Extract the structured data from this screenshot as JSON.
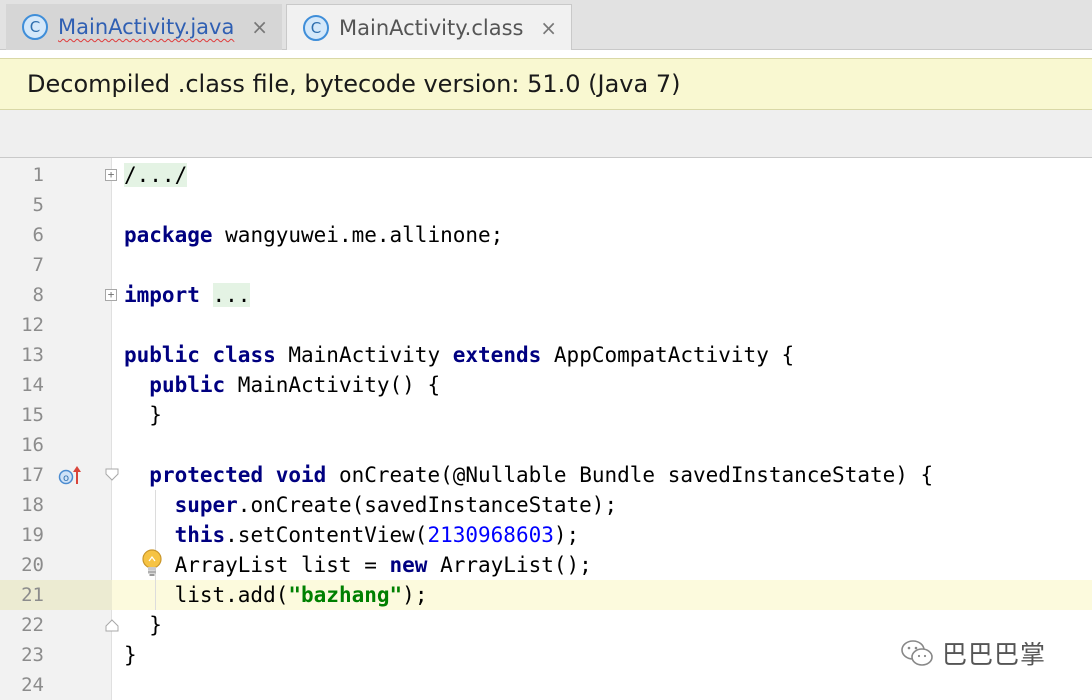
{
  "tabs": [
    {
      "icon": "C",
      "label": "MainActivity.java",
      "close": "×",
      "active": false,
      "has_error_underline": true
    },
    {
      "icon": "C",
      "label": "MainActivity.class",
      "close": "×",
      "active": true
    }
  ],
  "banner": {
    "text": "Decompiled .class file, bytecode version: 51.0 (Java 7)"
  },
  "editor": {
    "current_line": "21",
    "lines": [
      {
        "n": "1",
        "code": [
          {
            "t": "/.../",
            "c": "fold"
          }
        ],
        "fold": "+"
      },
      {
        "n": "5",
        "code": []
      },
      {
        "n": "6",
        "code": [
          {
            "t": "package",
            "c": "kw"
          },
          {
            "t": " wangyuwei.me.allinone;",
            "c": ""
          }
        ]
      },
      {
        "n": "7",
        "code": []
      },
      {
        "n": "8",
        "code": [
          {
            "t": "import",
            "c": "kw"
          },
          {
            "t": " ",
            "c": ""
          },
          {
            "t": "...",
            "c": "fold"
          }
        ],
        "fold": "+"
      },
      {
        "n": "12",
        "code": []
      },
      {
        "n": "13",
        "code": [
          {
            "t": "public",
            "c": "kw"
          },
          {
            "t": " ",
            "c": ""
          },
          {
            "t": "class",
            "c": "kw"
          },
          {
            "t": " MainActivity ",
            "c": ""
          },
          {
            "t": "extends",
            "c": "kw"
          },
          {
            "t": " AppCompatActivity {",
            "c": ""
          }
        ]
      },
      {
        "n": "14",
        "code": [
          {
            "t": "  ",
            "c": ""
          },
          {
            "t": "public",
            "c": "kw"
          },
          {
            "t": " MainActivity() {",
            "c": ""
          }
        ]
      },
      {
        "n": "15",
        "code": [
          {
            "t": "  }",
            "c": ""
          }
        ]
      },
      {
        "n": "16",
        "code": []
      },
      {
        "n": "17",
        "code": [
          {
            "t": "  ",
            "c": ""
          },
          {
            "t": "protected",
            "c": "kw"
          },
          {
            "t": " ",
            "c": ""
          },
          {
            "t": "void",
            "c": "kw"
          },
          {
            "t": " onCreate(@Nullable Bundle savedInstanceState) {",
            "c": ""
          }
        ],
        "fold": "open"
      },
      {
        "n": "18",
        "code": [
          {
            "t": "    ",
            "c": ""
          },
          {
            "t": "super",
            "c": "kw"
          },
          {
            "t": ".onCreate(savedInstanceState);",
            "c": ""
          }
        ]
      },
      {
        "n": "19",
        "code": [
          {
            "t": "    ",
            "c": ""
          },
          {
            "t": "this",
            "c": "kw"
          },
          {
            "t": ".setContentView(",
            "c": ""
          },
          {
            "t": "2130968603",
            "c": "num"
          },
          {
            "t": ");",
            "c": ""
          }
        ]
      },
      {
        "n": "20",
        "code": [
          {
            "t": "    ArrayList list = ",
            "c": ""
          },
          {
            "t": "new",
            "c": "kw"
          },
          {
            "t": " ArrayList();",
            "c": ""
          }
        ]
      },
      {
        "n": "21",
        "code": [
          {
            "t": "    list.add(",
            "c": ""
          },
          {
            "t": "\"bazhang\"",
            "c": "str"
          },
          {
            "t": ");",
            "c": ""
          }
        ]
      },
      {
        "n": "22",
        "code": [
          {
            "t": "  }",
            "c": ""
          }
        ],
        "fold": "close"
      },
      {
        "n": "23",
        "code": [
          {
            "t": "}",
            "c": ""
          }
        ]
      },
      {
        "n": "24",
        "code": []
      }
    ]
  },
  "icons": {
    "tab_icon": "class-c-icon",
    "override": "override-method-icon",
    "bulb": "intention-bulb-icon",
    "watermark": "wechat-logo-icon"
  },
  "colors": {
    "keyword": "#000080",
    "number": "#0000ff",
    "string": "#008000",
    "banner_bg": "#f9f8d1",
    "current_line_bg": "#fcfadd"
  },
  "watermark": {
    "text": "巴巴巴掌"
  }
}
